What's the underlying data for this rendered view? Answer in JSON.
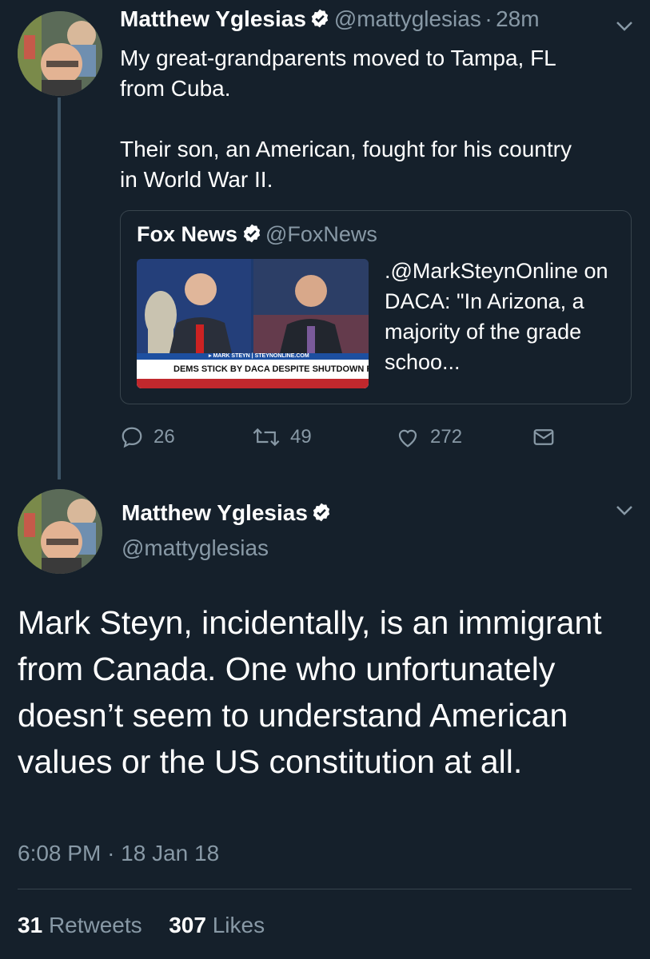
{
  "tweet1": {
    "name": "Matthew Yglesias",
    "handle": "@mattyglesias",
    "sep": "·",
    "time": "28m",
    "text": "My great-grandparents moved to Tampa, FL\nfrom Cuba.\n\nTheir son, an American, fought for his country\nin World War II.",
    "quote": {
      "name": "Fox News",
      "handle": "@FoxNews",
      "text": ".@MarkSteynOnline on DACA: \"In Arizona, a majority of the grade schoo...",
      "chyron_small": "▸ MARK STEYN | STEYNONLINE.COM",
      "chyron": "DEMS STICK BY DACA DESPITE SHUTDOWN RISK"
    },
    "actions": {
      "replies": "26",
      "retweets": "49",
      "likes": "272"
    }
  },
  "tweet2": {
    "name": "Matthew Yglesias",
    "handle": "@mattyglesias",
    "text": "Mark Steyn, incidentally, is an immigrant from Canada. One who unfortunately doesn’t seem to understand American values or the US constitution at all.",
    "time": "6:08 PM",
    "sep": "·",
    "date": "18 Jan 18",
    "retweets_count": "31",
    "retweets_label": "Retweets",
    "likes_count": "307",
    "likes_label": "Likes"
  },
  "colors": {
    "background": "#15202b",
    "secondary_text": "#8899a6",
    "border": "#38444d",
    "accent": "#1da1f2"
  },
  "icons": [
    "chevron-down-icon",
    "verified-icon",
    "reply-icon",
    "retweet-icon",
    "like-icon",
    "dm-icon"
  ]
}
